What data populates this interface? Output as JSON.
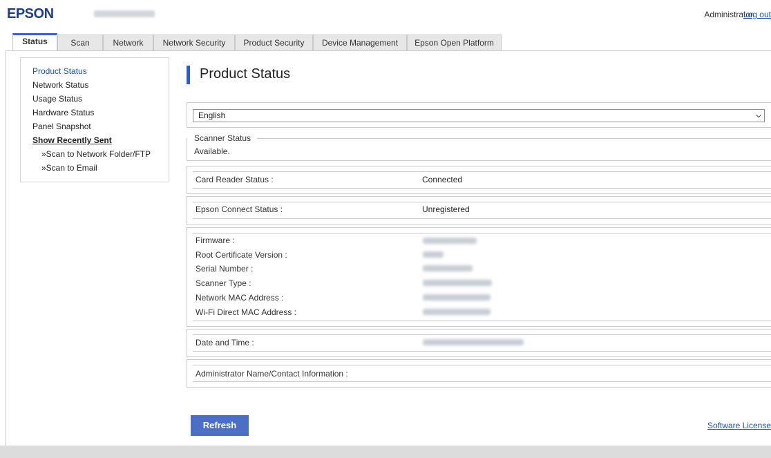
{
  "header": {
    "logo": "EPSON",
    "user": "Administrator",
    "logout": "Log out"
  },
  "tabs": [
    {
      "label": "Status",
      "active": true
    },
    {
      "label": "Scan"
    },
    {
      "label": "Network"
    },
    {
      "label": "Network Security"
    },
    {
      "label": "Product Security"
    },
    {
      "label": "Device Management"
    },
    {
      "label": "Epson Open Platform"
    }
  ],
  "sidebar": {
    "items": [
      {
        "label": "Product Status",
        "active": true
      },
      {
        "label": "Network Status"
      },
      {
        "label": "Usage Status"
      },
      {
        "label": "Hardware Status"
      },
      {
        "label": "Panel Snapshot"
      },
      {
        "label": "Show Recently Sent"
      },
      {
        "label": "»Scan to Network Folder/FTP"
      },
      {
        "label": "»Scan to Email"
      }
    ]
  },
  "main": {
    "title": "Product Status",
    "language": "English",
    "scanner_status_legend": "Scanner Status",
    "scanner_status_value": "Available.",
    "card_reader": {
      "label": "Card Reader Status :",
      "value": "Connected"
    },
    "epson_connect": {
      "label": "Epson Connect Status :",
      "value": "Unregistered"
    },
    "info": [
      {
        "label": "Firmware :"
      },
      {
        "label": "Root Certificate Version :"
      },
      {
        "label": "Serial Number :"
      },
      {
        "label": "Scanner Type :"
      },
      {
        "label": "Network MAC Address :"
      },
      {
        "label": "Wi-Fi Direct MAC Address :"
      }
    ],
    "date_time_label": "Date and Time :",
    "admin_label": "Administrator Name/Contact Information :",
    "refresh": "Refresh",
    "license": "Software License"
  },
  "colors": {
    "accent": "#2f5bd1",
    "link": "#1a4fb5",
    "button": "#4b6fc4",
    "logo": "#1f3d8f"
  }
}
